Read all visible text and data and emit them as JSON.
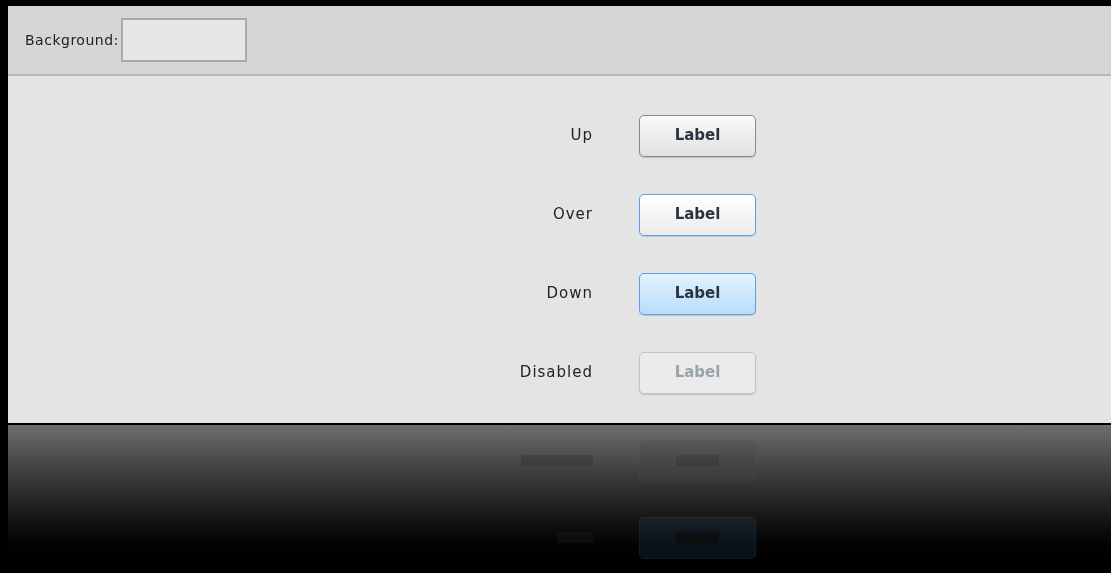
{
  "toolbar": {
    "label": "Background:"
  },
  "rows": [
    {
      "label": "Up",
      "button": "Label",
      "kind": "up"
    },
    {
      "label": "Over",
      "button": "Label",
      "kind": "over"
    },
    {
      "label": "Down",
      "button": "Label",
      "kind": "down"
    },
    {
      "label": "Disabled",
      "button": "Label",
      "kind": "disabled"
    }
  ]
}
